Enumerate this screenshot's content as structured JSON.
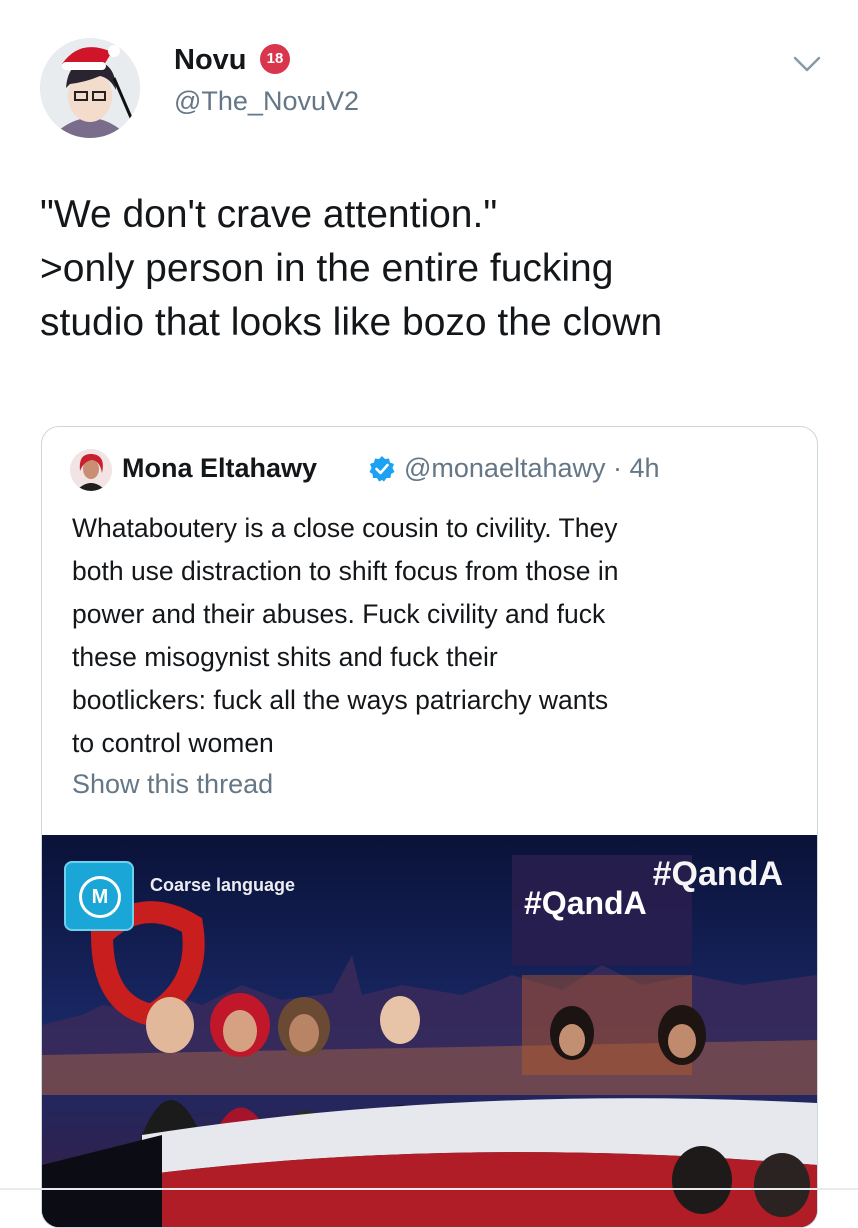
{
  "tweet": {
    "author": {
      "display_name": "Novu",
      "badge": "18",
      "handle": "@The_NovuV2"
    },
    "text_lines": [
      "\"We don't crave attention.\"",
      ">only person in the entire fucking",
      "studio that looks like bozo the clown"
    ],
    "menu_icon": "chevron-down-icon"
  },
  "quoted_tweet": {
    "author": {
      "display_name": "Mona Eltahawy",
      "verified_icon": "verified-badge-icon",
      "handle_time": "@monaeltahawy · 4h"
    },
    "text_lines": [
      "Whataboutery is a close cousin to civility. They",
      "both use distraction to shift focus from those in",
      "power and their abuses. Fuck civility and fuck",
      "these misogynist shits and fuck their",
      "bootlickers: fuck all the ways patriarchy wants",
      "to control women"
    ],
    "show_thread": "Show this thread",
    "media": {
      "rating_letter": "M",
      "rating_label": "Coarse language",
      "hashtag_back": "#QandA",
      "hashtag_front": "#QandA"
    }
  },
  "colors": {
    "text_primary": "#14171a",
    "text_secondary": "#657786",
    "verified_blue": "#1da1f2",
    "border": "#ccd6dd",
    "badge_red": "#d9354c"
  }
}
